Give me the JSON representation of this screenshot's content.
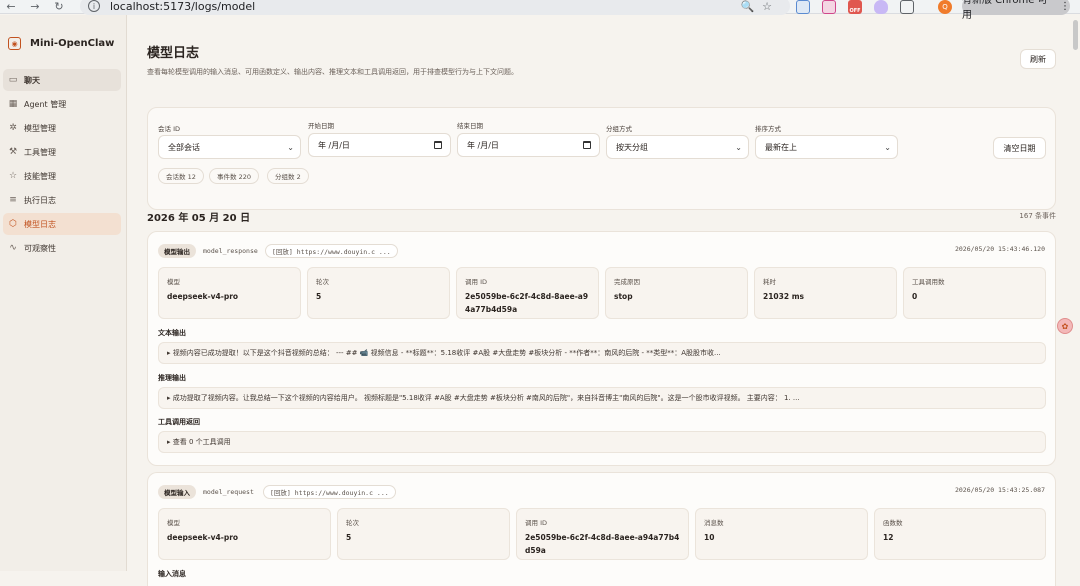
{
  "browser": {
    "url": "localhost:5173/logs/model",
    "update_label": "有新版 Chrome 可用",
    "badge_off": "OFF",
    "profile_initial": "Q"
  },
  "sidebar": {
    "brand": "Mini-OpenClaw",
    "items": [
      {
        "label": "聊天",
        "icon": "chat-icon"
      },
      {
        "label": "Agent 管理",
        "icon": "grid-icon"
      },
      {
        "label": "模型管理",
        "icon": "sparkle-icon"
      },
      {
        "label": "工具管理",
        "icon": "wrench-icon"
      },
      {
        "label": "技能管理",
        "icon": "star-icon"
      },
      {
        "label": "执行日志",
        "icon": "list-icon"
      },
      {
        "label": "模型日志",
        "icon": "cube-icon"
      },
      {
        "label": "可观察性",
        "icon": "pulse-icon"
      }
    ]
  },
  "header": {
    "title": "模型日志",
    "description": "查看每轮模型调用的输入消息、可用函数定义、输出内容、推理文本和工具调用返回，用于排查模型行为与上下文问题。",
    "refresh_label": "刷新"
  },
  "filters": {
    "session_label": "会话 ID",
    "session_value": "全部会话",
    "start_label": "开始日期",
    "start_value": "年 /月/日",
    "end_label": "结束日期",
    "end_value": "年 /月/日",
    "group_label": "分组方式",
    "group_value": "按天分组",
    "sort_label": "排序方式",
    "sort_value": "最新在上",
    "clear_label": "清空日期",
    "pills": [
      "会话数 12",
      "事件数 220",
      "分组数 2"
    ]
  },
  "day": {
    "title": "2026 年 05 月 20 日",
    "count": "167 条事件"
  },
  "cards": [
    {
      "tag": "模型输出",
      "kind": "model_response",
      "replay": "[回放] https://www.douyin.c ...",
      "timestamp": "2026/05/20 15:43:46.120",
      "stats": [
        {
          "label": "模型",
          "value": "deepseek-v4-pro"
        },
        {
          "label": "轮次",
          "value": "5"
        },
        {
          "label": "调用 ID",
          "value": "2e5059be-6c2f-4c8d-8aee-a94a77b4d59a"
        },
        {
          "label": "完成原因",
          "value": "stop"
        },
        {
          "label": "耗时",
          "value": "21032 ms"
        },
        {
          "label": "工具调用数",
          "value": "0"
        }
      ],
      "sections": [
        {
          "title": "文本输出",
          "detail": "▸ 视频内容已成功提取！以下是这个抖音视频的总结： --- ## 📹 视频信息 - **标题**：5.18收评 #A股 #大盘走势 #板块分析 - **作者**：南风的后院 - **类型**：A股股市收..."
        },
        {
          "title": "推理输出",
          "detail": "▸ 成功提取了视频内容。让我总结一下这个视频的内容给用户。 视频标题是\"5.18收评 #A股 #大盘走势 #板块分析 #南风的后院\"，来自抖音博主\"南风的后院\"。这是一个股市收评视频。 主要内容： 1. ..."
        },
        {
          "title": "工具调用返回",
          "detail": "▸ 查看 0 个工具调用"
        }
      ]
    },
    {
      "tag": "模型输入",
      "kind": "model_request",
      "replay": "[回放] https://www.douyin.c ...",
      "timestamp": "2026/05/20 15:43:25.087",
      "stats": [
        {
          "label": "模型",
          "value": "deepseek-v4-pro"
        },
        {
          "label": "轮次",
          "value": "5"
        },
        {
          "label": "调用 ID",
          "value": "2e5059be-6c2f-4c8d-8aee-a94a77b4d59a"
        },
        {
          "label": "消息数",
          "value": "10"
        },
        {
          "label": "函数数",
          "value": "12"
        }
      ],
      "sections": [
        {
          "title": "输入消息"
        }
      ]
    }
  ]
}
